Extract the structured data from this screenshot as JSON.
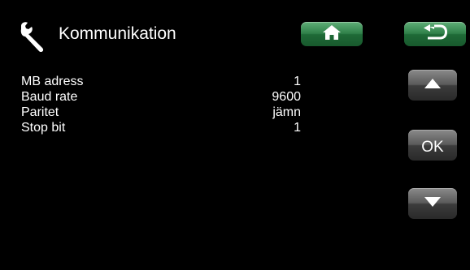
{
  "header": {
    "icon": "wrench-icon",
    "title": "Kommunikation"
  },
  "nav": {
    "home_icon": "home-icon",
    "back_icon": "back-arrow-icon"
  },
  "settings": [
    {
      "label": "MB adress",
      "value": "1"
    },
    {
      "label": "Baud rate",
      "value": "9600"
    },
    {
      "label": "Paritet",
      "value": "jämn"
    },
    {
      "label": "Stop bit",
      "value": "1"
    }
  ],
  "side_buttons": {
    "up_icon": "arrow-up-icon",
    "ok_label": "OK",
    "down_icon": "arrow-down-icon"
  },
  "colors": {
    "background": "#000000",
    "text": "#ffffff",
    "nav_button": "#2f8049",
    "side_button": "#5a5a5a"
  }
}
